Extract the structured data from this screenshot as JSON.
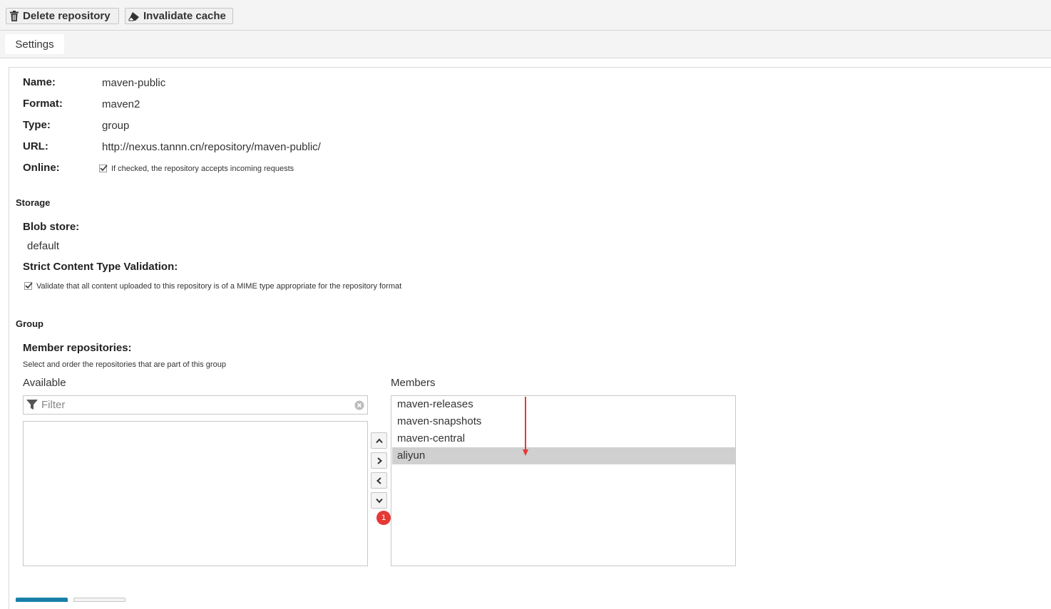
{
  "toolbar": {
    "delete_label": "Delete repository",
    "invalidate_label": "Invalidate cache"
  },
  "tabs": {
    "settings": "Settings"
  },
  "repo": {
    "name_label": "Name:",
    "name": "maven-public",
    "format_label": "Format:",
    "format": "maven2",
    "type_label": "Type:",
    "type": "group",
    "url_label": "URL:",
    "url": "http://nexus.tannn.cn/repository/maven-public/",
    "online_label": "Online:",
    "online_checked": true,
    "online_hint": "If checked, the repository accepts incoming requests"
  },
  "storage": {
    "section": "Storage",
    "blob_label": "Blob store:",
    "blob_value": "default",
    "strict_label": "Strict Content Type Validation:",
    "strict_checked": true,
    "strict_hint": "Validate that all content uploaded to this repository is of a MIME type appropriate for the repository format"
  },
  "group": {
    "section": "Group",
    "member_label": "Member repositories:",
    "member_hint": "Select and order the repositories that are part of this group",
    "available_label": "Available",
    "filter_placeholder": "Filter",
    "members_label": "Members",
    "members": [
      "maven-releases",
      "maven-snapshots",
      "maven-central",
      "aliyun"
    ],
    "selected_member": "aliyun",
    "badge_count": "1"
  },
  "colors": {
    "badge": "#e53935",
    "arrow": "#e53935",
    "selected_row": "#d0d0d0",
    "save_button": "#1a7fa8"
  }
}
